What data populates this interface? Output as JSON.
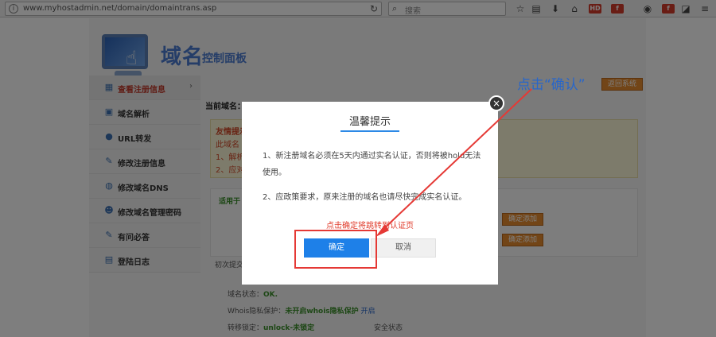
{
  "browser": {
    "url": "www.myhostadmin.net/domain/domaintrans.asp",
    "search_placeholder": "搜索"
  },
  "header": {
    "logo_title": "域名",
    "logo_subtitle": "控制面板"
  },
  "sidebar": {
    "items": [
      {
        "label": "查看注册信息",
        "icon": "document-icon",
        "arrow": "›"
      },
      {
        "label": "域名解析",
        "icon": "dns-icon"
      },
      {
        "label": "URL转发",
        "icon": "globe-icon"
      },
      {
        "label": "修改注册信息",
        "icon": "pen-icon"
      },
      {
        "label": "修改域名DNS",
        "icon": "server-icon"
      },
      {
        "label": "修改域名管理密码",
        "icon": "user-icon"
      },
      {
        "label": "有问必答",
        "icon": "pen-icon"
      },
      {
        "label": "登陆日志",
        "icon": "log-icon"
      }
    ]
  },
  "main": {
    "current_domain_label": "当前域名：",
    "return_button": "返回系统",
    "notice_lines": [
      "友情提示",
      "此域名",
      "1、解析",
      "2、应对"
    ],
    "apply_title": "适用于",
    "add_buttons": [
      "确定添加",
      "确定添加"
    ],
    "hint_line": "初次提交……                                                                                   成MX记录和邮件交换记录。",
    "status": {
      "domain_status_label": "域名状态：",
      "domain_status_value": "OK.",
      "whois_label": "Whois隐私保护：",
      "whois_value": "未开启whois隐私保护",
      "whois_link": "开启",
      "transfer_label": "转移锁定：",
      "transfer_value": "unlock-未锁定",
      "security_label": "安全状态"
    }
  },
  "modal": {
    "title": "温馨提示",
    "paragraph1": "1、新注册域名必须在5天内通过实名认证，否则将被hold无法使用。",
    "paragraph2": "2、应政策要求，原来注册的域名也请尽快完成实名认证。",
    "redirect_notice": "点击确定将跳转到认证页",
    "ok_button": "确定",
    "cancel_button": "取消",
    "close_symbol": "×"
  },
  "annotation": {
    "text": "点击“确认”",
    "color": "#e53935"
  }
}
